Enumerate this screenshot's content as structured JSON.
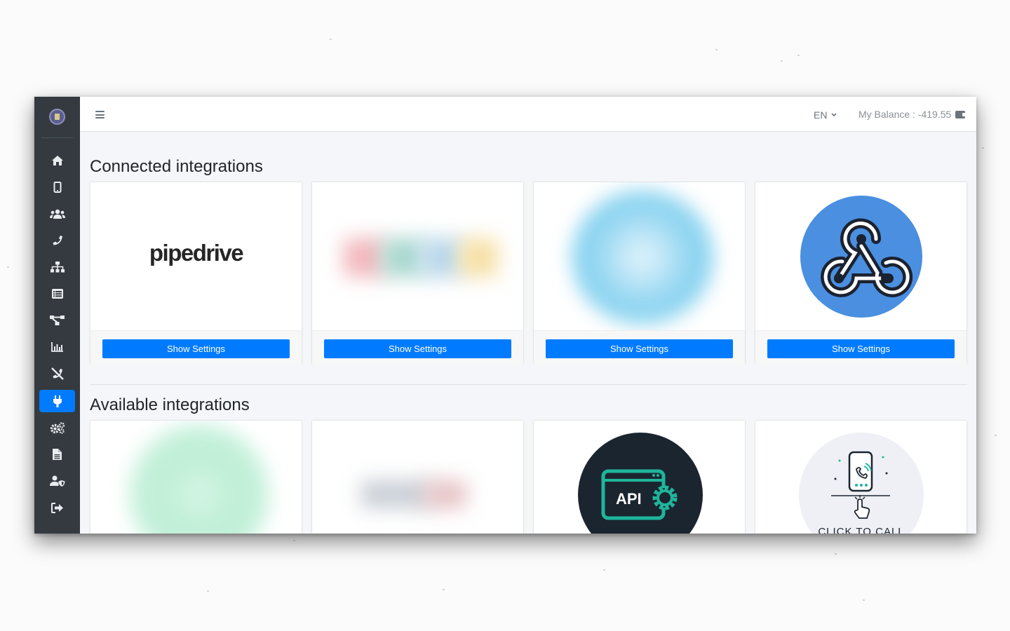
{
  "topbar": {
    "language": "EN",
    "balance_text": "My Balance : -419.55"
  },
  "sidebar": {
    "items": [
      {
        "name": "home-icon"
      },
      {
        "name": "mobile-icon"
      },
      {
        "name": "users-icon"
      },
      {
        "name": "phone-icon"
      },
      {
        "name": "sitemap-icon"
      },
      {
        "name": "list-icon"
      },
      {
        "name": "flow-icon"
      },
      {
        "name": "chart-icon"
      },
      {
        "name": "call-off-icon"
      },
      {
        "name": "plug-icon",
        "active": true
      },
      {
        "name": "cogs-icon"
      },
      {
        "name": "document-icon"
      },
      {
        "name": "user-shield-icon"
      },
      {
        "name": "sign-out-icon"
      }
    ]
  },
  "connected": {
    "title": "Connected integrations",
    "cards": [
      {
        "logo_text": "pipedrive",
        "button": "Show Settings"
      },
      {
        "logo_text": "",
        "button": "Show Settings"
      },
      {
        "logo_text": "",
        "button": "Show Settings"
      },
      {
        "logo_text": "",
        "icon": "webhook-icon",
        "button": "Show Settings"
      }
    ]
  },
  "available": {
    "title": "Available integrations",
    "cards": [
      {
        "logo_text": ""
      },
      {
        "logo_text": ""
      },
      {
        "logo_text": "API",
        "icon": "api-gear-icon"
      },
      {
        "logo_text": "CLICK TO CALL",
        "icon": "click-to-call-icon"
      }
    ]
  },
  "colors": {
    "sidebar_bg": "#343a40",
    "accent": "#007bff",
    "webhook_blue": "#4a8fe0",
    "api_teal": "#1fb59b"
  }
}
